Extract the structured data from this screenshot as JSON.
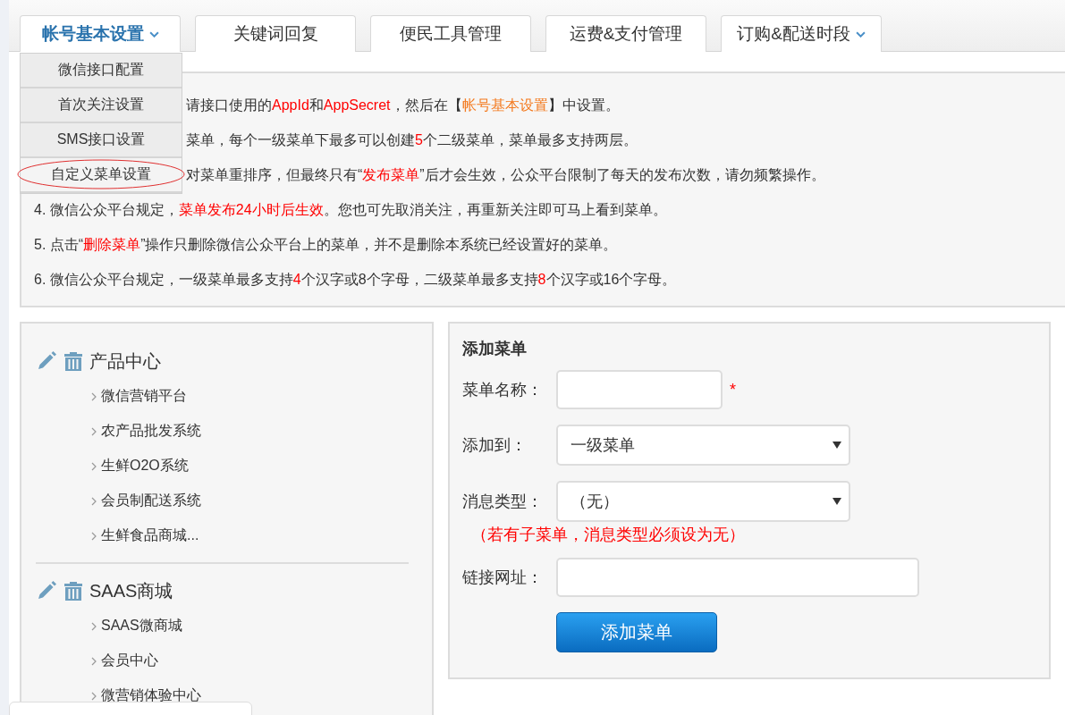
{
  "tabs": [
    {
      "label": "帐号基本设置",
      "selected": true,
      "has_dropdown": true
    },
    {
      "label": "关键词回复",
      "selected": false,
      "has_dropdown": false
    },
    {
      "label": "便民工具管理",
      "selected": false,
      "has_dropdown": false
    },
    {
      "label": "运费&支付管理",
      "selected": false,
      "has_dropdown": false
    },
    {
      "label": "订购&配送时段",
      "selected": false,
      "has_dropdown": true
    }
  ],
  "dropdown": {
    "expanded": true,
    "items": [
      {
        "label": "微信接口配置",
        "highlighted": false
      },
      {
        "label": "首次关注设置",
        "highlighted": false
      },
      {
        "label": "SMS接口设置",
        "highlighted": false
      },
      {
        "label": "自定义菜单设置",
        "highlighted": true
      }
    ]
  },
  "notes": [
    {
      "partly_hidden": true,
      "segments": [
        {
          "text": "请接口使用的"
        },
        {
          "text": "AppId",
          "color": "#ff0000"
        },
        {
          "text": "和"
        },
        {
          "text": "AppSecret",
          "color": "#ff0000"
        },
        {
          "text": "，然后在【"
        },
        {
          "text": "帐号基本设置",
          "color": "#f47a1f"
        },
        {
          "text": "】中设置。"
        }
      ]
    },
    {
      "partly_hidden": true,
      "segments": [
        {
          "text": "菜单，每个一级菜单下最多可以创建"
        },
        {
          "text": "5",
          "color": "#ff0000"
        },
        {
          "text": "个二级菜单，菜单最多支持两层。"
        }
      ]
    },
    {
      "partly_hidden": true,
      "segments": [
        {
          "text": "对菜单重排序，但最终只有“"
        },
        {
          "text": "发布菜单",
          "color": "#ff0000"
        },
        {
          "text": "”后才会生效，公众平台限制了每天的发布次数，请勿频繁操作。"
        }
      ]
    },
    {
      "segments": [
        {
          "text": "4. 微信公众平台规定，"
        },
        {
          "text": "菜单发布24小时后生效",
          "color": "#ff0000"
        },
        {
          "text": "。您也可先取消关注，再重新关注即可马上看到菜单。"
        }
      ]
    },
    {
      "segments": [
        {
          "text": "5. 点击“"
        },
        {
          "text": "删除菜单",
          "color": "#ff0000"
        },
        {
          "text": "”操作只删除微信公众平台上的菜单，并不是删除本系统已经设置好的菜单。"
        }
      ]
    },
    {
      "segments": [
        {
          "text": "6. 微信公众平台规定，一级菜单最多支持"
        },
        {
          "text": "4",
          "color": "#ff0000"
        },
        {
          "text": "个汉字或8个字母，二级菜单最多支持"
        },
        {
          "text": "8",
          "color": "#ff0000"
        },
        {
          "text": "个汉字或16个字母。"
        }
      ]
    }
  ],
  "menu_tree": [
    {
      "label": "产品中心",
      "children": [
        {
          "label": "微信营销平台"
        },
        {
          "label": "农产品批发系统"
        },
        {
          "label": "生鲜O2O系统"
        },
        {
          "label": "会员制配送系统"
        },
        {
          "label": "生鲜食品商城..."
        }
      ]
    },
    {
      "label": "SAAS商城",
      "children": [
        {
          "label": "SAAS微商城"
        },
        {
          "label": "会员中心"
        },
        {
          "label": "微营销体验中心"
        }
      ]
    }
  ],
  "form": {
    "title": "添加菜单",
    "fields": [
      {
        "kind": "text",
        "label": "菜单名称：",
        "required": true
      },
      {
        "kind": "select",
        "label": "添加到：",
        "value": "一级菜单"
      },
      {
        "kind": "select",
        "label": "消息类型：",
        "value": "（无）",
        "hint": "（若有子菜单，消息类型必须设为无）"
      },
      {
        "kind": "text",
        "label": "链接网址："
      }
    ],
    "required_mark": "*",
    "submit": "添加菜单"
  }
}
